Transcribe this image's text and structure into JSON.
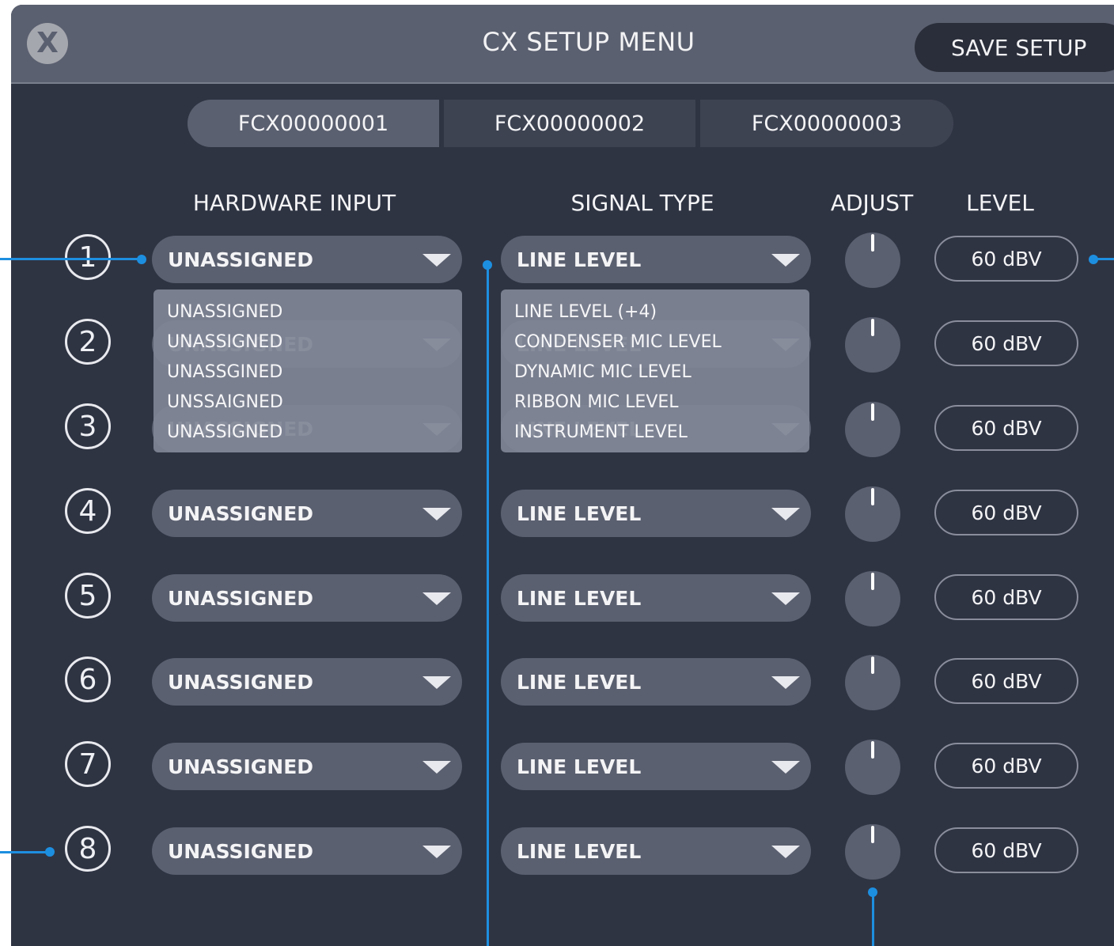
{
  "window": {
    "title": "CX SETUP MENU",
    "close_label": "X",
    "save_label": "SAVE SETUP"
  },
  "tabs": [
    {
      "label": "FCX00000001",
      "active": true
    },
    {
      "label": "FCX00000002",
      "active": false
    },
    {
      "label": "FCX00000003",
      "active": false
    }
  ],
  "columns": {
    "hardware_input": "HARDWARE INPUT",
    "signal_type": "SIGNAL TYPE",
    "adjust": "ADJUST",
    "level": "LEVEL"
  },
  "channels": [
    {
      "number": "1",
      "hardware_input": "UNASSIGNED",
      "signal_type": "LINE LEVEL",
      "level": "60 dBV"
    },
    {
      "number": "2",
      "hardware_input": "UNASSIGNED",
      "signal_type": "LINE LEVEL",
      "level": "60 dBV"
    },
    {
      "number": "3",
      "hardware_input": "UNASSIGNED",
      "signal_type": "LINE LEVEL",
      "level": "60 dBV"
    },
    {
      "number": "4",
      "hardware_input": "UNASSIGNED",
      "signal_type": "LINE LEVEL",
      "level": "60 dBV"
    },
    {
      "number": "5",
      "hardware_input": "UNASSIGNED",
      "signal_type": "LINE LEVEL",
      "level": "60 dBV"
    },
    {
      "number": "6",
      "hardware_input": "UNASSIGNED",
      "signal_type": "LINE LEVEL",
      "level": "60 dBV"
    },
    {
      "number": "7",
      "hardware_input": "UNASSIGNED",
      "signal_type": "LINE LEVEL",
      "level": "60 dBV"
    },
    {
      "number": "8",
      "hardware_input": "UNASSIGNED",
      "signal_type": "LINE LEVEL",
      "level": "60 dBV"
    }
  ],
  "hardware_input_options": [
    "UNASSIGNED",
    "UNASSIGNED",
    "UNASSGINED",
    "UNSSAIGNED",
    "UNASSIGNED"
  ],
  "signal_type_options": [
    "LINE LEVEL (+4)",
    "CONDENSER MIC LEVEL",
    "DYNAMIC MIC LEVEL",
    "RIBBON MIC LEVEL",
    "INSTRUMENT LEVEL"
  ],
  "colors": {
    "panel": "#2f3443",
    "titlebar": "#5b6070",
    "control": "#5b6070",
    "callout": "#1d8fe0"
  },
  "icons": {
    "close": "close-icon",
    "dropdown": "triangle-down-icon"
  }
}
